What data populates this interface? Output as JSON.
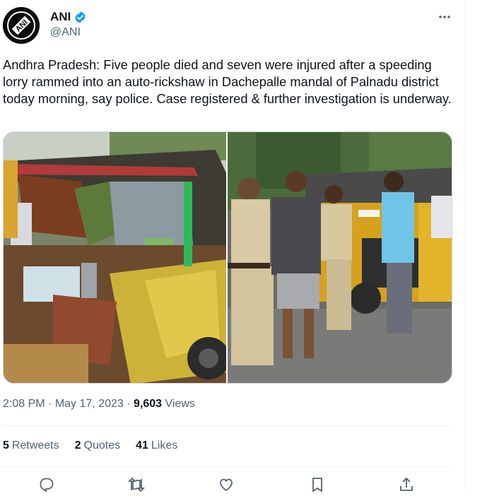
{
  "author": {
    "name": "ANI",
    "handle": "@ANI",
    "avatar_text": "ANI",
    "verified": true
  },
  "tweet": {
    "text": "Andhra Pradesh: Five people died and seven were injured after a speeding lorry rammed into an auto-rickshaw in Dachepalle mandal of Palnadu district today morning, say police. Case registered & further investigation is underway."
  },
  "meta": {
    "time": "2:08 PM",
    "sep1": " · ",
    "date": "May 17, 2023",
    "sep2": " · ",
    "views_count": "9,603",
    "views_label": " Views"
  },
  "stats": [
    {
      "count": "5",
      "label": "Retweets"
    },
    {
      "count": "2",
      "label": "Quotes"
    },
    {
      "count": "41",
      "label": "Likes"
    }
  ],
  "icons": {
    "verified": "verified-badge-icon",
    "more": "more-options-icon",
    "reply": "reply-icon",
    "retweet": "retweet-icon",
    "like": "like-icon",
    "bookmark": "bookmark-icon",
    "share": "share-icon"
  },
  "colors": {
    "text": "#0f1419",
    "secondary": "#536471",
    "verified": "#1d9bf0",
    "border": "#eff3f4"
  }
}
